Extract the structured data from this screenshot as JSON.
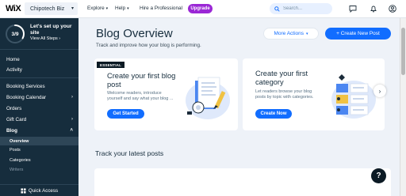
{
  "topbar": {
    "logo": "WiX",
    "site_name": "Chipotech Biz",
    "nav": [
      {
        "label": "Explore",
        "has_dropdown": true
      },
      {
        "label": "Help",
        "has_dropdown": true
      },
      {
        "label": "Hire a Professional",
        "has_dropdown": false
      }
    ],
    "upgrade_label": "Upgrade",
    "search_placeholder": "Search...",
    "icons": [
      "search-icon",
      "chat-icon",
      "bell-icon",
      "avatar-icon"
    ],
    "colors": {
      "upgrade": "#9a27d5",
      "search_bg": "#e7f0ff"
    }
  },
  "sidebar": {
    "progress": "3/9",
    "progress_fraction": 0.33,
    "setup_title": "Let's set up your site",
    "view_steps": "View All Steps",
    "items": [
      {
        "label": "Home"
      },
      {
        "label": "Activity"
      },
      {
        "label": "Booking Services"
      },
      {
        "label": "Booking Calendar",
        "chevron": ">"
      },
      {
        "label": "Orders"
      },
      {
        "label": "Gift Card",
        "chevron": ">"
      },
      {
        "label": "Blog",
        "chevron": "^"
      }
    ],
    "blog_sub": [
      {
        "label": "Overview",
        "active": true
      },
      {
        "label": "Posts"
      },
      {
        "label": "Categories"
      },
      {
        "label": "Writers"
      }
    ],
    "quick_access": "Quick Access",
    "colors": {
      "bg": "#162d3d",
      "active_row": "#2e4657"
    }
  },
  "main": {
    "title": "Blog Overview",
    "subtitle": "Track and improve how your blog is performing.",
    "more_actions": "More Actions",
    "create_post": "+ Create New Post",
    "cards": [
      {
        "badge": "ESSENTIAL",
        "title": "Create your first blog post",
        "description": "Welcome readers, introduce yourself and say what your blog ...",
        "button": "Get Started"
      },
      {
        "title": "Create your first category",
        "description": "Let readers browse your blog posts by topic with categories.",
        "button": "Create Now"
      }
    ],
    "next_arrow": "›",
    "section_title": "Track your latest posts",
    "help_label": "?",
    "colors": {
      "primary": "#116dff",
      "page_bg": "#eef2f8"
    }
  }
}
